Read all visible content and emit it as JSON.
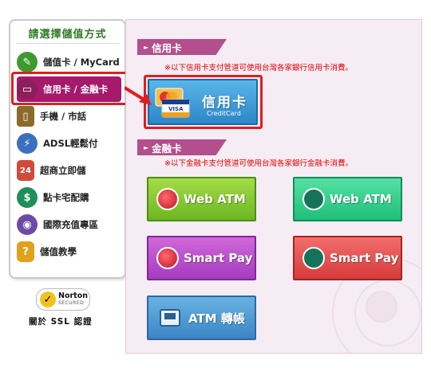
{
  "sidebar": {
    "title": "請選擇儲值方式",
    "items": [
      {
        "label": "儲值卡 / MyCard",
        "icon": "mycard-icon",
        "color": "#3c9a2e",
        "active": false
      },
      {
        "label": "信用卡 / 金融卡",
        "icon": "credit-card-icon",
        "color": "#8a1f5c",
        "active": true
      },
      {
        "label": "手機 / 市話",
        "icon": "phone-icon",
        "color": "#8a6b2a",
        "active": false
      },
      {
        "label": "ADSL輕鬆付",
        "icon": "adsl-icon",
        "color": "#3b6fc0",
        "active": false
      },
      {
        "label": "超商立即儲",
        "icon": "store-icon",
        "color": "#d24a3a",
        "active": false
      },
      {
        "label": "點卡宅配購",
        "icon": "house-dollar-icon",
        "color": "#1e8f5a",
        "active": false
      },
      {
        "label": "國際充值專區",
        "icon": "globe-icon",
        "color": "#6e4aa8",
        "active": false
      },
      {
        "label": "儲值教學",
        "icon": "help-icon",
        "color": "#e0a21a",
        "active": false
      }
    ]
  },
  "norton": {
    "name": "Norton",
    "sub": "SECURED"
  },
  "ssl_link": "關於 SSL 認證",
  "main": {
    "credit_section": {
      "tag": "信用卡",
      "notice": "※以下信用卡支付管道可使用台灣各家銀行信用卡消費。",
      "card": {
        "title": "信用卡",
        "subtitle": "CreditCard"
      }
    },
    "debit_section": {
      "tag": "金融卡",
      "notice": "※以下金融卡支付管道可使用台灣各家銀行金融卡消費。",
      "buttons": [
        {
          "label": "Web ATM",
          "style": "green",
          "icon": "mylife-icon"
        },
        {
          "label": "Web ATM",
          "style": "teal",
          "icon": "mountain-icon"
        },
        {
          "label": "Smart Pay",
          "style": "purple",
          "icon": "mylife-icon"
        },
        {
          "label": "Smart Pay",
          "style": "red",
          "icon": "mountain-icon"
        },
        {
          "label": "ATM 轉帳",
          "style": "blue",
          "icon": "atm-screen-icon"
        }
      ]
    }
  },
  "colors": {
    "accent": "#a51a6a",
    "highlight": "#e01d1d",
    "notice": "#e00000",
    "panel_bg": "#f6ecf3"
  }
}
